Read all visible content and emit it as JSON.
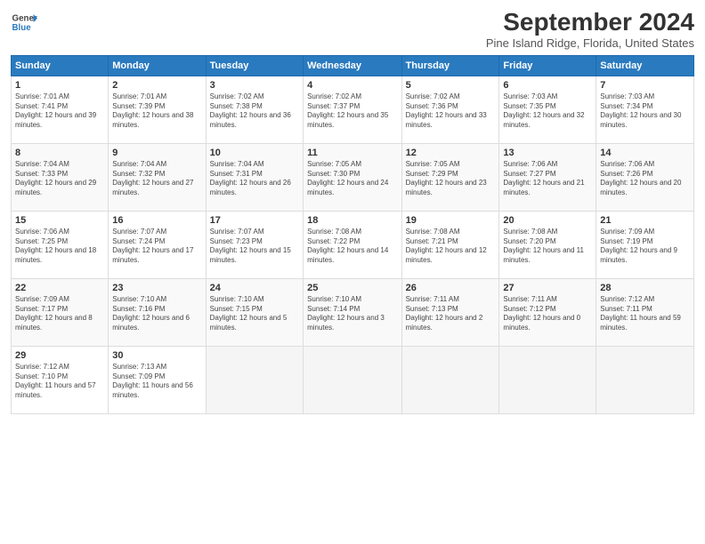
{
  "header": {
    "logo_line1": "General",
    "logo_line2": "Blue",
    "title": "September 2024",
    "subtitle": "Pine Island Ridge, Florida, United States"
  },
  "calendar": {
    "days_of_week": [
      "Sunday",
      "Monday",
      "Tuesday",
      "Wednesday",
      "Thursday",
      "Friday",
      "Saturday"
    ],
    "weeks": [
      [
        null,
        {
          "day": "2",
          "sunrise": "7:01 AM",
          "sunset": "7:39 PM",
          "daylight": "12 hours and 38 minutes."
        },
        {
          "day": "3",
          "sunrise": "7:02 AM",
          "sunset": "7:38 PM",
          "daylight": "12 hours and 36 minutes."
        },
        {
          "day": "4",
          "sunrise": "7:02 AM",
          "sunset": "7:37 PM",
          "daylight": "12 hours and 35 minutes."
        },
        {
          "day": "5",
          "sunrise": "7:02 AM",
          "sunset": "7:36 PM",
          "daylight": "12 hours and 33 minutes."
        },
        {
          "day": "6",
          "sunrise": "7:03 AM",
          "sunset": "7:35 PM",
          "daylight": "12 hours and 32 minutes."
        },
        {
          "day": "7",
          "sunrise": "7:03 AM",
          "sunset": "7:34 PM",
          "daylight": "12 hours and 30 minutes."
        }
      ],
      [
        {
          "day": "1",
          "sunrise": "7:01 AM",
          "sunset": "7:41 PM",
          "daylight": "12 hours and 39 minutes."
        },
        null,
        null,
        null,
        null,
        null,
        null
      ],
      [
        {
          "day": "8",
          "sunrise": "7:04 AM",
          "sunset": "7:33 PM",
          "daylight": "12 hours and 29 minutes."
        },
        {
          "day": "9",
          "sunrise": "7:04 AM",
          "sunset": "7:32 PM",
          "daylight": "12 hours and 27 minutes."
        },
        {
          "day": "10",
          "sunrise": "7:04 AM",
          "sunset": "7:31 PM",
          "daylight": "12 hours and 26 minutes."
        },
        {
          "day": "11",
          "sunrise": "7:05 AM",
          "sunset": "7:30 PM",
          "daylight": "12 hours and 24 minutes."
        },
        {
          "day": "12",
          "sunrise": "7:05 AM",
          "sunset": "7:29 PM",
          "daylight": "12 hours and 23 minutes."
        },
        {
          "day": "13",
          "sunrise": "7:06 AM",
          "sunset": "7:27 PM",
          "daylight": "12 hours and 21 minutes."
        },
        {
          "day": "14",
          "sunrise": "7:06 AM",
          "sunset": "7:26 PM",
          "daylight": "12 hours and 20 minutes."
        }
      ],
      [
        {
          "day": "15",
          "sunrise": "7:06 AM",
          "sunset": "7:25 PM",
          "daylight": "12 hours and 18 minutes."
        },
        {
          "day": "16",
          "sunrise": "7:07 AM",
          "sunset": "7:24 PM",
          "daylight": "12 hours and 17 minutes."
        },
        {
          "day": "17",
          "sunrise": "7:07 AM",
          "sunset": "7:23 PM",
          "daylight": "12 hours and 15 minutes."
        },
        {
          "day": "18",
          "sunrise": "7:08 AM",
          "sunset": "7:22 PM",
          "daylight": "12 hours and 14 minutes."
        },
        {
          "day": "19",
          "sunrise": "7:08 AM",
          "sunset": "7:21 PM",
          "daylight": "12 hours and 12 minutes."
        },
        {
          "day": "20",
          "sunrise": "7:08 AM",
          "sunset": "7:20 PM",
          "daylight": "12 hours and 11 minutes."
        },
        {
          "day": "21",
          "sunrise": "7:09 AM",
          "sunset": "7:19 PM",
          "daylight": "12 hours and 9 minutes."
        }
      ],
      [
        {
          "day": "22",
          "sunrise": "7:09 AM",
          "sunset": "7:17 PM",
          "daylight": "12 hours and 8 minutes."
        },
        {
          "day": "23",
          "sunrise": "7:10 AM",
          "sunset": "7:16 PM",
          "daylight": "12 hours and 6 minutes."
        },
        {
          "day": "24",
          "sunrise": "7:10 AM",
          "sunset": "7:15 PM",
          "daylight": "12 hours and 5 minutes."
        },
        {
          "day": "25",
          "sunrise": "7:10 AM",
          "sunset": "7:14 PM",
          "daylight": "12 hours and 3 minutes."
        },
        {
          "day": "26",
          "sunrise": "7:11 AM",
          "sunset": "7:13 PM",
          "daylight": "12 hours and 2 minutes."
        },
        {
          "day": "27",
          "sunrise": "7:11 AM",
          "sunset": "7:12 PM",
          "daylight": "12 hours and 0 minutes."
        },
        {
          "day": "28",
          "sunrise": "7:12 AM",
          "sunset": "7:11 PM",
          "daylight": "11 hours and 59 minutes."
        }
      ],
      [
        {
          "day": "29",
          "sunrise": "7:12 AM",
          "sunset": "7:10 PM",
          "daylight": "11 hours and 57 minutes."
        },
        {
          "day": "30",
          "sunrise": "7:13 AM",
          "sunset": "7:09 PM",
          "daylight": "11 hours and 56 minutes."
        },
        null,
        null,
        null,
        null,
        null
      ]
    ]
  },
  "labels": {
    "sunrise": "Sunrise:",
    "sunset": "Sunset:",
    "daylight": "Daylight:"
  }
}
